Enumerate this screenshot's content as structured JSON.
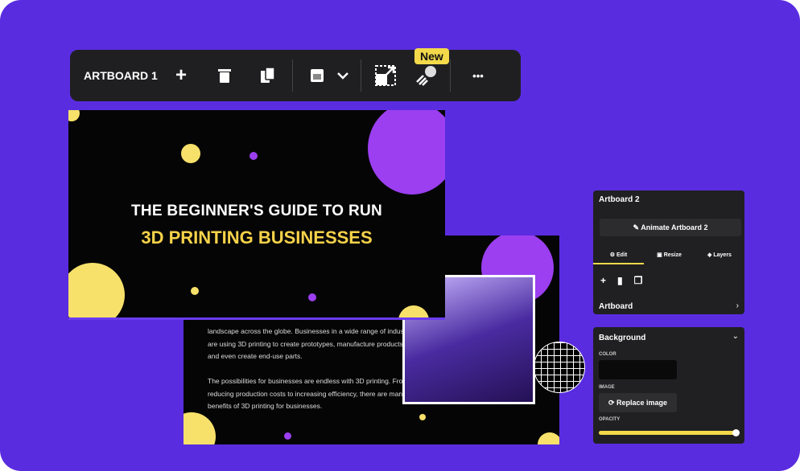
{
  "toolbar": {
    "title": "ARTBOARD 1",
    "new_badge": "New",
    "more": "•••"
  },
  "artboard1": {
    "line1": "THE BEGINNER'S GUIDE TO RUN",
    "line2": "3D PRINTING BUSINESSES"
  },
  "artboard2": {
    "para1": "landscape across the globe. Businesses in a wide range of industries are using 3D printing to create prototypes, manufacture products, and even create end-use parts.",
    "para2": "The possibilities for businesses are endless with 3D printing. From reducing production costs to increasing efficiency, there are many benefits of 3D printing for businesses."
  },
  "panel1": {
    "title": "Artboard 2",
    "animate": "Animate Artboard 2",
    "tabs": [
      "Edit",
      "Resize",
      "Layers"
    ],
    "active_tab": "Edit",
    "section": "Artboard"
  },
  "panel2": {
    "title": "Background",
    "color_label": "COLOR",
    "color_value": "#0a0a0a",
    "image_label": "IMAGE",
    "replace": "Replace image",
    "opacity_label": "OPACITY",
    "opacity": 100
  },
  "colors": {
    "background": "#5a2ce0",
    "accent": "#f4d94a",
    "panel": "#202022"
  }
}
